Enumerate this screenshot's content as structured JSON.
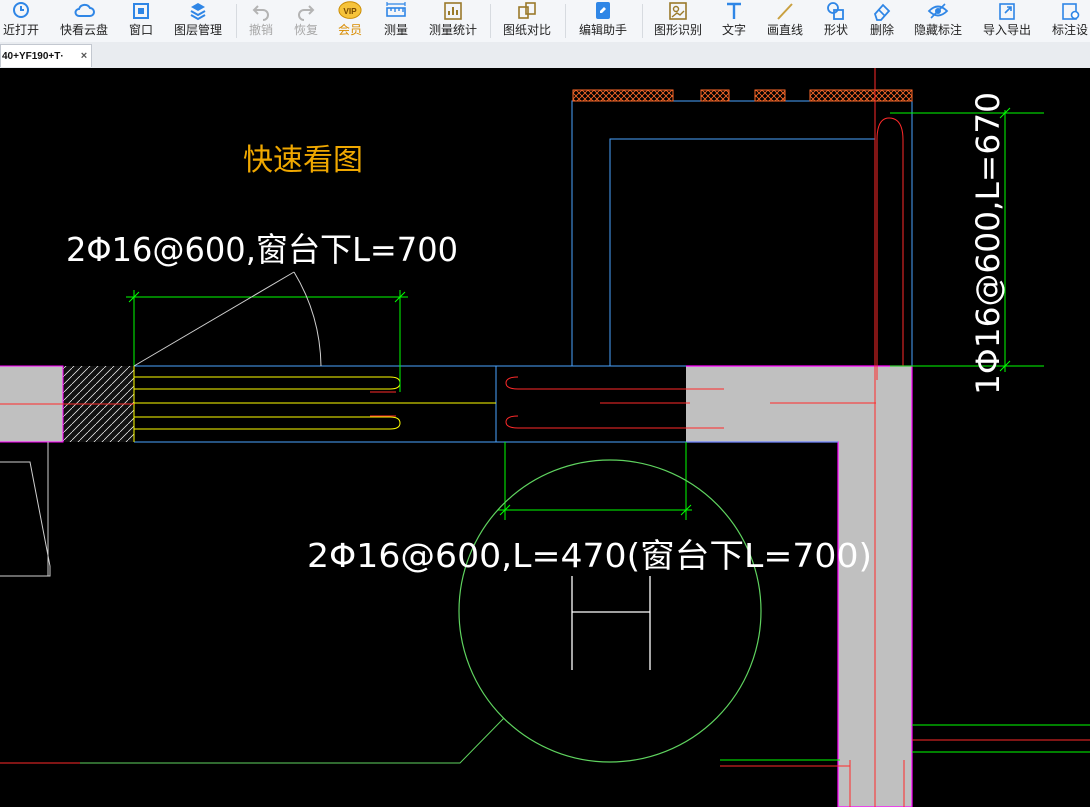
{
  "toolbar": {
    "recent_open": "近打开",
    "quick_cloud": "快看云盘",
    "window": "窗口",
    "layer_manage": "图层管理",
    "undo": "撤销",
    "redo": "恢复",
    "vip_badge": "VIP",
    "member": "会员",
    "measure": "测量",
    "measure_stats": "测量统计",
    "compare": "图纸对比",
    "edit_assistant": "编辑助手",
    "shape_recognize": "图形识别",
    "text": "文字",
    "draw_line": "画直线",
    "shape": "形状",
    "delete": "删除",
    "hide_annotation": "隐藏标注",
    "import_export": "导入导出",
    "annotation_settings": "标注设"
  },
  "tabs": {
    "active_title": "40+YF190+T·",
    "close": "×"
  },
  "drawing": {
    "watermark": "快速看图",
    "label_top": "2Φ16@600,窗台下L=700",
    "label_mid": "2Φ16@600,L=470(窗台下L=700)",
    "label_vertical": "1Φ16@600,L=670",
    "colors": {
      "background": "#000000",
      "wall_fill": "#c0c0c0",
      "wall_outline": "#ff00ff",
      "window_blue": "#4aa3ff",
      "rebar_yellow": "#ffff00",
      "rebar_red": "#ff2a2a",
      "dimension_green": "#00ff00",
      "circle_green": "#5fd35f",
      "watermark": "#f0a800",
      "text_white": "#ffffff"
    }
  }
}
